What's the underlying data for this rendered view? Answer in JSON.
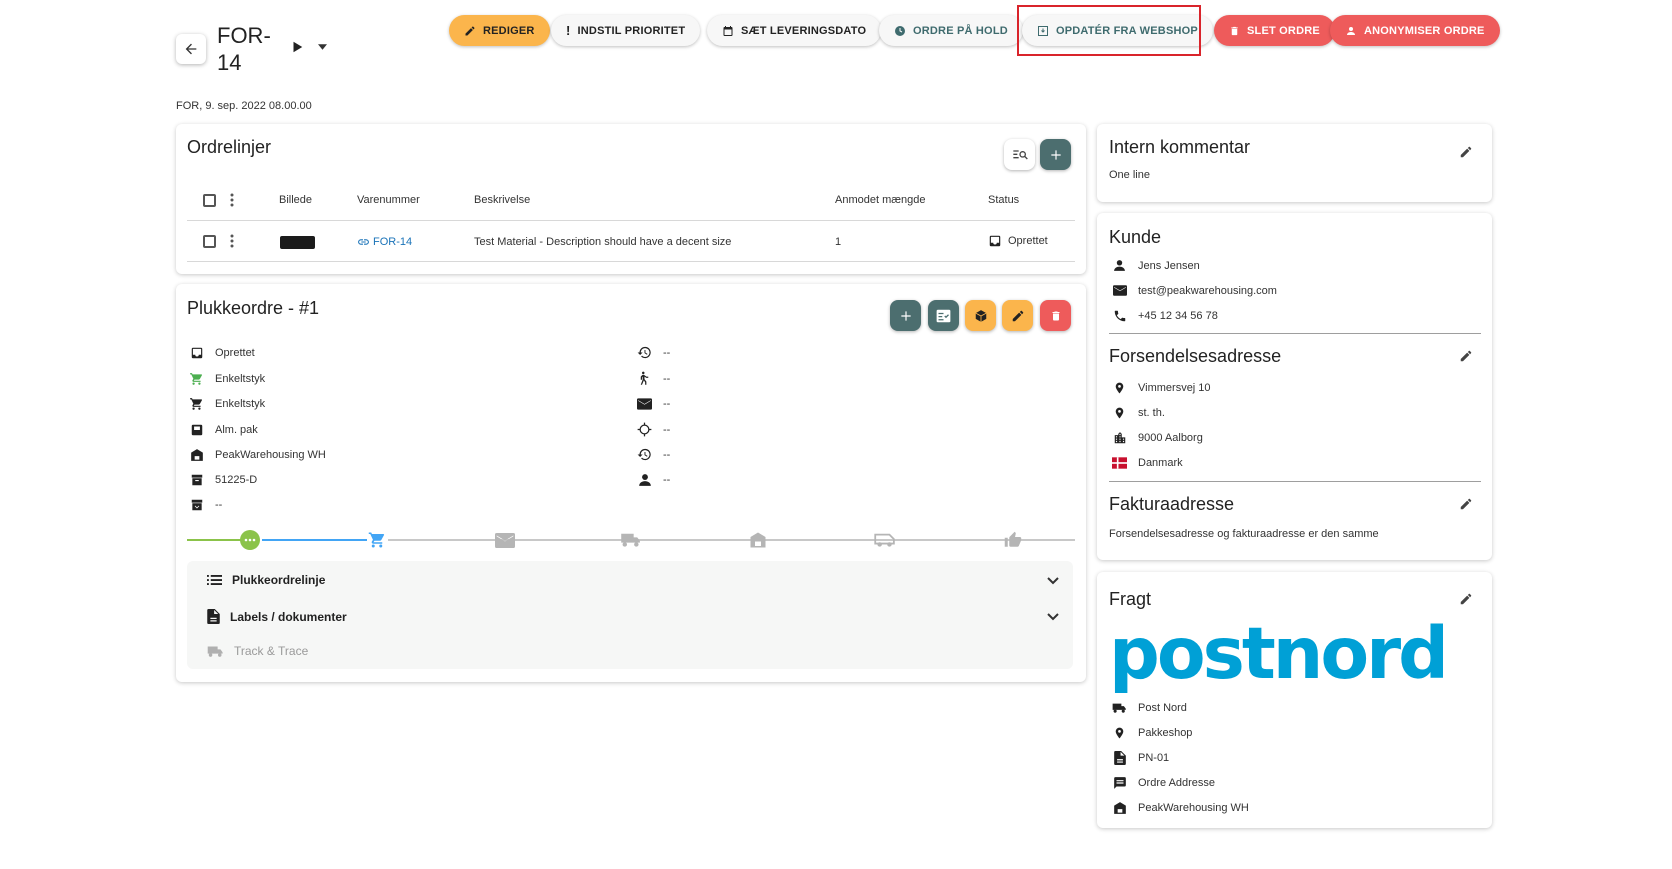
{
  "header": {
    "title": "FOR-14",
    "subtitle": "FOR, 9. sep. 2022 08.00.00",
    "actions": {
      "edit": "REDIGER",
      "priority": "INDSTIL PRIORITET",
      "delivery_date": "SÆT LEVERINGSDATO",
      "hold": "ORDRE PÅ HOLD",
      "update_webshop": "OPDATÉR FRA WEBSHOP",
      "delete": "SLET ORDRE",
      "anonymize": "ANONYMISER ORDRE"
    }
  },
  "order_lines": {
    "title": "Ordrelinjer",
    "columns": [
      "Billede",
      "Varenummer",
      "Beskrivelse",
      "Anmodet mængde",
      "Status"
    ],
    "rows": [
      {
        "sku": "FOR-14",
        "description": "Test Material - Description should have a decent size",
        "quantity": "1",
        "status": "Oprettet"
      }
    ]
  },
  "pick_order": {
    "title": "Plukkeordre - #1",
    "left_info": [
      "Oprettet",
      "Enkeltstyk",
      "Enkeltstyk",
      "Alm. pak",
      "PeakWarehousing WH",
      "51225-D",
      "--"
    ],
    "right_info": [
      "--",
      "--",
      "--",
      "--",
      "--",
      "--"
    ],
    "sections": {
      "lines": "Plukkeordrelinje",
      "labels": "Labels / dokumenter",
      "track": "Track & Trace"
    }
  },
  "internal_comment": {
    "title": "Intern kommentar",
    "text": "One line"
  },
  "customer": {
    "title": "Kunde",
    "name": "Jens Jensen",
    "email": "test@peakwarehousing.com",
    "phone": "+45 12 34 56 78"
  },
  "shipping_address": {
    "title": "Forsendelsesadresse",
    "street": "Vimmersvej 10",
    "floor": "st. th.",
    "city": "9000 Aalborg",
    "country": "Danmark"
  },
  "billing_address": {
    "title": "Fakturaadresse",
    "text": "Forsendelsesadresse og fakturaadresse er den samme"
  },
  "freight": {
    "title": "Fragt",
    "logo_text": "postnord",
    "carrier": "Post Nord",
    "product": "Pakkeshop",
    "code": "PN-01",
    "address": "Ordre Addresse",
    "warehouse": "PeakWarehousing WH"
  },
  "colors": {
    "accent_yellow": "#fbb54c",
    "danger_red": "#ee5b5b",
    "teal": "#4c6e6f",
    "link_blue": "#1a73b8",
    "postnord_blue": "#00a0d6",
    "step_green": "#8bc34a",
    "step_blue": "#42a5f5",
    "highlight_red": "#d9242b"
  }
}
